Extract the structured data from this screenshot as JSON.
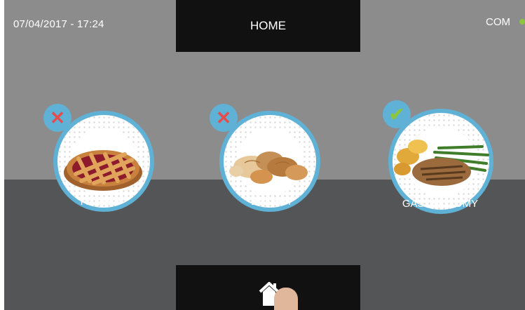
{
  "header": {
    "datetime": "07/04/2017 - 17:24",
    "title": "HOME",
    "status_label": "COM",
    "status_color": "#8cc63f"
  },
  "categories": [
    {
      "label": "PASTRY",
      "status": "x-icon",
      "status_glyph": "✕"
    },
    {
      "label": "BAKERY",
      "status": "x-icon",
      "status_glyph": "✕"
    },
    {
      "label": "GASTRONOMY",
      "status": "check-icon",
      "status_glyph": "✔"
    }
  ],
  "footer": {
    "home_icon": "home-icon"
  },
  "colors": {
    "accent": "#5fb1d6",
    "error": "#e74c4c",
    "success": "#8cc63f",
    "bg_top": "#8c8c8c",
    "bg_bottom": "#545557",
    "bar": "#111111"
  }
}
